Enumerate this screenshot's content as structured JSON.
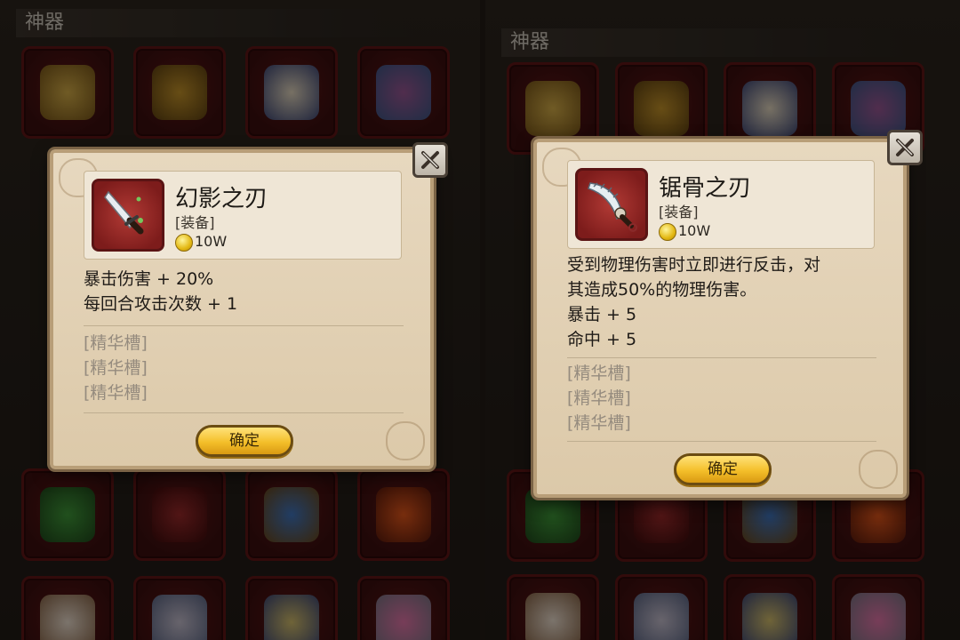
{
  "left": {
    "header": "神器",
    "dialog": {
      "item_name": "幻影之刃",
      "item_type": "[装备]",
      "price": "10W",
      "desc_lines": [
        "暴击伤害 + 20%",
        "每回合攻击次数 + 1"
      ],
      "slots": [
        "[精华槽]",
        "[精华槽]",
        "[精华槽]"
      ],
      "confirm_label": "确定",
      "icon": "dagger-icon"
    }
  },
  "right": {
    "header": "神器",
    "dialog": {
      "item_name": "锯骨之刃",
      "item_type": "[装备]",
      "price": "10W",
      "desc_lines": [
        "受到物理伤害时立即进行反击，对",
        "其造成50%的物理伤害。",
        "暴击 + 5",
        "命中 + 5"
      ],
      "slots": [
        "[精华槽]",
        "[精华槽]",
        "[精华槽]"
      ],
      "confirm_label": "确定",
      "icon": "bone-blade-icon"
    }
  },
  "colors": {
    "cell_bg": "#4a1212",
    "dialog_bg": "#e2d2b6",
    "confirm_gold": "#f4bf2a"
  },
  "grid_items": [
    "winged-axe-icon",
    "leather-bag-icon",
    "winged-boots-icon",
    "magic-shield-icon",
    "green-feather-icon",
    "red-sword-icon",
    "blue-orb-icon",
    "fire-orb-icon",
    "horn-icon",
    "tome-icon",
    "laurel-crest-icon",
    "jewel-crown-icon"
  ]
}
